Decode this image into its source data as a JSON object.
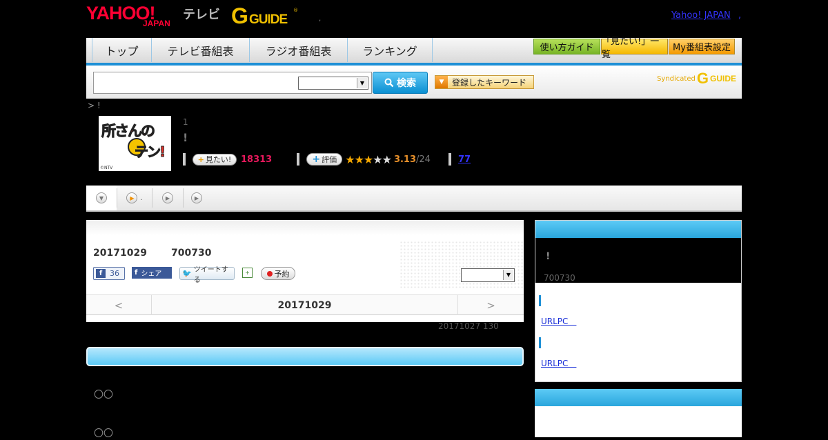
{
  "header": {
    "yahoo_logo": "YAHOO!",
    "yahoo_sub": "JAPAN",
    "tv_label": "テレビ",
    "gguide_g": "G",
    "gguide_rest": "GUIDE",
    "gguide_reg": "®",
    "sep_dot": ",",
    "yahoo_link": "Yahoo! JAPAN",
    "yahoo_link_suffix": ","
  },
  "nav": {
    "tabs": [
      {
        "label": "トップ"
      },
      {
        "label": "テレビ番組表"
      },
      {
        "label": "ラジオ番組表"
      },
      {
        "label": "ランキング"
      }
    ],
    "guide_buttons": [
      {
        "label": "使い方ガイド"
      },
      {
        "label": "「見たい!」一覧"
      },
      {
        "label": "My番組表設定"
      }
    ]
  },
  "search": {
    "input_value": "",
    "select_value": "",
    "button_label": "検索",
    "keyword_button_label": "登録したキーワード",
    "syndicated_text": "Syndicated",
    "syndicated_logo_g": "G",
    "syndicated_logo_rest": "GUIDE"
  },
  "breadcrumb": "> !",
  "program": {
    "thumb_text": "所さんの",
    "thumb_text2": "テン!",
    "thumb_copyright": "©NTV",
    "episode_num": "1",
    "title": "!",
    "mitai_label": "見たい!",
    "mitai_count": "18313",
    "rate_label": "評価",
    "rating": "3.13",
    "rating_count": "/24",
    "stars_filled": 3,
    "stars_total": 5,
    "reviews": "77"
  },
  "tabstrip": {
    "items": [
      {
        "text": ""
      },
      {
        "text": "."
      },
      {
        "text": ""
      },
      {
        "text": ""
      }
    ]
  },
  "airing": {
    "date": "20171029",
    "time": "700730",
    "fb_like_count": "36",
    "fb_share_label": "シェア",
    "tweet_label": "ツイートする",
    "reserve_label": "予約",
    "nav_prev": "<",
    "nav_date": "20171029",
    "nav_next": ">",
    "update_info": "20171027  130"
  },
  "content": {
    "circles1": "〇〇",
    "circles2": "〇〇"
  },
  "sidebar": {
    "exclaim": "!",
    "duration": "700730",
    "link1": "URLPC　",
    "link2": "URLPC　"
  },
  "colors": {
    "accent_blue": "#1e90d6",
    "yahoo_red": "#ff0033",
    "gguide_yellow": "#f0c000"
  }
}
